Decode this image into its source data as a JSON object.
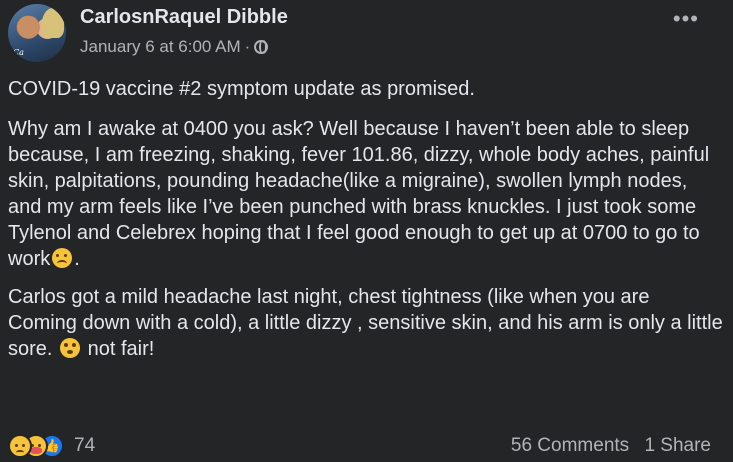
{
  "post": {
    "author": "CarlosnRaquel Dibble",
    "timestamp": "January 6 at 6:00 AM",
    "separator": "·",
    "privacy_icon": "globe-icon",
    "more_label": "•••"
  },
  "content": {
    "paragraph1": "COVID-19 vaccine #2 symptom update as promised.",
    "paragraph2": "Why am I awake at 0400 you ask?  Well because I haven’t been able to sleep because, I am freezing, shaking, fever 101.86, dizzy, whole body aches, painful skin, palpitations, pounding headache(like a migraine), swollen lymph nodes, and my arm feels like I’ve been punched with brass knuckles.  I just took some Tylenol and Celebrex hoping that I feel good enough to get up at 0700 to go to work",
    "paragraph2_end": ".",
    "paragraph3_line1": "Carlos got a mild headache last night, chest tightness (like when you are",
    "paragraph3_line2": "Coming down with a cold), a little dizzy , sensitive skin, and his arm is only a little sore.",
    "paragraph3_end": " not fair!"
  },
  "footer": {
    "reaction_icons": [
      "sad-reaction-icon",
      "care-reaction-icon",
      "like-reaction-icon"
    ],
    "reaction_count": "74",
    "comments": "56 Comments",
    "shares": "1 Share"
  }
}
